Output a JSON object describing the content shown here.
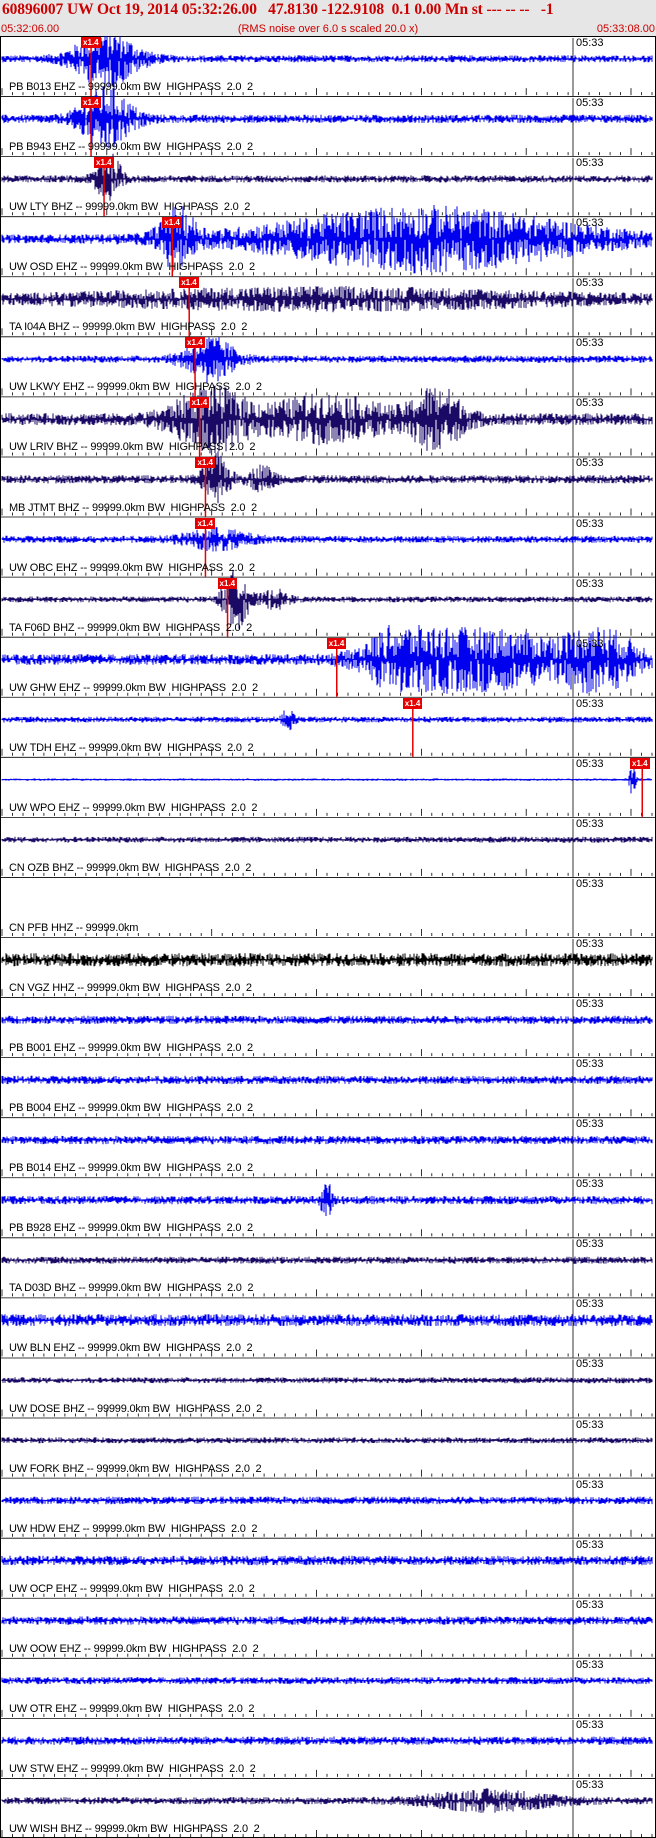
{
  "header": {
    "title": "60896007 UW Oct 19, 2014 05:32:26.00   47.8130 -122.9108  0.1 0.00 Mn st --- -- --   -1",
    "start_time": "05:32:06.00",
    "scale_note": "(RMS noise over 6.0 s scaled 20.0 x)",
    "end_time": "05:33:08.00"
  },
  "colors": {
    "title": "#cc0000",
    "header_bg": "#e6e6e6",
    "pick": "#e60000",
    "trace_blue": "#0000ee",
    "trace_navy": "#1a0a66",
    "trace_black": "#000000"
  },
  "chart_data": {
    "type": "line",
    "time_range": [
      "05:32:06.00",
      "05:33:08.00"
    ],
    "minute_mark": "05:33",
    "series": [
      {
        "name": "PB B013 EHZ -- 99999.0km BW  HIGHPASS  2.0  2",
        "pick": "x1.4",
        "pick_t": 0.137,
        "color": "blue",
        "events": [
          [
            0.16,
            0.9,
            0.05
          ]
        ],
        "noise": 0.12
      },
      {
        "name": "PB B943 EHZ -- 99999.0km BW  HIGHPASS  2.0  2",
        "pick": "x1.4",
        "pick_t": 0.137,
        "color": "blue",
        "events": [
          [
            0.16,
            1.0,
            0.04
          ]
        ],
        "noise": 0.14
      },
      {
        "name": "UW LTY BHZ -- 99999.0km BW  HIGHPASS  2.0  2",
        "pick": "x1.4",
        "pick_t": 0.157,
        "color": "navy",
        "events": [
          [
            0.165,
            0.8,
            0.02
          ]
        ],
        "noise": 0.12
      },
      {
        "name": "UW OSD EHZ -- 99999.0km BW  HIGHPASS  2.0  2",
        "pick": "x1.4",
        "pick_t": 0.262,
        "color": "blue",
        "events": [
          [
            0.27,
            0.9,
            0.03
          ],
          [
            0.65,
            1.0,
            0.25
          ]
        ],
        "noise": 0.15
      },
      {
        "name": "TA I04A BHZ -- 99999.0km BW  HIGHPASS  2.0  2",
        "pick": "x1.4",
        "pick_t": 0.288,
        "color": "navy",
        "events": [
          [
            0.5,
            0.3,
            0.4
          ]
        ],
        "noise": 0.14
      },
      {
        "name": "UW LKWY EHZ -- 99999.0km BW  HIGHPASS  2.0  2",
        "pick": "x1.4",
        "pick_t": 0.297,
        "color": "blue",
        "events": [
          [
            0.32,
            0.7,
            0.04
          ]
        ],
        "noise": 0.12
      },
      {
        "name": "UW LRIV BHZ -- 99999.0km BW  HIGHPASS  2.0  2",
        "pick": "x1.4",
        "pick_t": 0.304,
        "color": "navy",
        "events": [
          [
            0.32,
            0.95,
            0.06
          ],
          [
            0.5,
            0.7,
            0.1
          ],
          [
            0.67,
            1.0,
            0.04
          ]
        ],
        "noise": 0.2
      },
      {
        "name": "MB JTMT BHZ -- 99999.0km BW  HIGHPASS  2.0  2",
        "pick": "x1.4",
        "pick_t": 0.313,
        "color": "navy",
        "events": [
          [
            0.33,
            0.8,
            0.02
          ],
          [
            0.4,
            0.4,
            0.02
          ]
        ],
        "noise": 0.14
      },
      {
        "name": "UW OBC EHZ -- 99999.0km BW  HIGHPASS  2.0  2",
        "pick": "x1.4",
        "pick_t": 0.313,
        "color": "blue",
        "events": [
          [
            0.33,
            0.3,
            0.05
          ]
        ],
        "noise": 0.12
      },
      {
        "name": "TA F06D BHZ -- 99999.0km BW  HIGHPASS  2.0  2",
        "pick": "x1.4",
        "pick_t": 0.347,
        "color": "navy",
        "events": [
          [
            0.36,
            0.95,
            0.02
          ],
          [
            0.42,
            0.3,
            0.02
          ]
        ],
        "noise": 0.1
      },
      {
        "name": "UW GHW EHZ -- 99999.0km BW  HIGHPASS  2.0  2",
        "pick": "x1.4",
        "pick_t": 0.515,
        "color": "blue",
        "events": [
          [
            0.62,
            1.0,
            0.06
          ],
          [
            0.75,
            0.9,
            0.12
          ],
          [
            0.92,
            0.9,
            0.06
          ]
        ],
        "noise": 0.18
      },
      {
        "name": "UW TDH EHZ -- 99999.0km BW  HIGHPASS  2.0  2",
        "pick": "x1.4",
        "pick_t": 0.632,
        "color": "blue",
        "events": [
          [
            0.44,
            0.3,
            0.01
          ]
        ],
        "noise": 0.1
      },
      {
        "name": "UW WPO EHZ -- 99999.0km BW  HIGHPASS  2.0  2",
        "pick": "x1.4",
        "pick_t": 0.985,
        "color": "blue",
        "events": [
          [
            0.97,
            0.6,
            0.005
          ]
        ],
        "noise": 0.04
      },
      {
        "name": "CN OZB BHZ -- 99999.0km BW  HIGHPASS  2.0  2",
        "pick": "",
        "pick_t": null,
        "color": "navy",
        "events": [],
        "noise": 0.1
      },
      {
        "name": "CN PFB HHZ -- 99999.0km",
        "pick": "",
        "pick_t": null,
        "color": "none",
        "events": [],
        "noise": 0
      },
      {
        "name": "CN VGZ HHZ -- 99999.0km BW  HIGHPASS  2.0  2",
        "pick": "",
        "pick_t": null,
        "color": "black",
        "events": [],
        "noise": 0.22
      },
      {
        "name": "PB B001 EHZ -- 99999.0km BW  HIGHPASS  2.0  2",
        "pick": "",
        "pick_t": null,
        "color": "blue",
        "events": [],
        "noise": 0.14
      },
      {
        "name": "PB B004 EHZ -- 99999.0km BW  HIGHPASS  2.0  2",
        "pick": "",
        "pick_t": null,
        "color": "blue",
        "events": [],
        "noise": 0.14
      },
      {
        "name": "PB B014 EHZ -- 99999.0km BW  HIGHPASS  2.0  2",
        "pick": "",
        "pick_t": null,
        "color": "blue",
        "events": [],
        "noise": 0.14
      },
      {
        "name": "PB B928 EHZ -- 99999.0km BW  HIGHPASS  2.0  2",
        "pick": "",
        "pick_t": null,
        "color": "blue",
        "events": [
          [
            0.5,
            0.5,
            0.01
          ]
        ],
        "noise": 0.14
      },
      {
        "name": "TA D03D BHZ -- 99999.0km BW  HIGHPASS  2.0  2",
        "pick": "",
        "pick_t": null,
        "color": "navy",
        "events": [],
        "noise": 0.12
      },
      {
        "name": "UW BLN EHZ -- 99999.0km BW  HIGHPASS  2.0  2",
        "pick": "",
        "pick_t": null,
        "color": "blue",
        "events": [],
        "noise": 0.2
      },
      {
        "name": "UW DOSE BHZ -- 99999.0km BW  HIGHPASS  2.0  2",
        "pick": "",
        "pick_t": null,
        "color": "navy",
        "events": [],
        "noise": 0.1
      },
      {
        "name": "UW FORK BHZ -- 99999.0km BW  HIGHPASS  2.0  2",
        "pick": "",
        "pick_t": null,
        "color": "navy",
        "events": [],
        "noise": 0.1
      },
      {
        "name": "UW HDW EHZ -- 99999.0km BW  HIGHPASS  2.0  2",
        "pick": "",
        "pick_t": null,
        "color": "blue",
        "events": [],
        "noise": 0.13
      },
      {
        "name": "UW OCP EHZ -- 99999.0km BW  HIGHPASS  2.0  2",
        "pick": "",
        "pick_t": null,
        "color": "blue",
        "events": [],
        "noise": 0.16
      },
      {
        "name": "UW OOW EHZ -- 99999.0km BW  HIGHPASS  2.0  2",
        "pick": "",
        "pick_t": null,
        "color": "blue",
        "events": [],
        "noise": 0.14
      },
      {
        "name": "UW OTR EHZ -- 99999.0km BW  HIGHPASS  2.0  2",
        "pick": "",
        "pick_t": null,
        "color": "blue",
        "events": [],
        "noise": 0.12
      },
      {
        "name": "UW STW EHZ -- 99999.0km BW  HIGHPASS  2.0  2",
        "pick": "",
        "pick_t": null,
        "color": "blue",
        "events": [],
        "noise": 0.14
      },
      {
        "name": "UW WISH BHZ -- 99999.0km BW  HIGHPASS  2.0  2",
        "pick": "",
        "pick_t": null,
        "color": "navy",
        "events": [
          [
            0.75,
            0.3,
            0.1
          ]
        ],
        "noise": 0.12
      }
    ]
  }
}
